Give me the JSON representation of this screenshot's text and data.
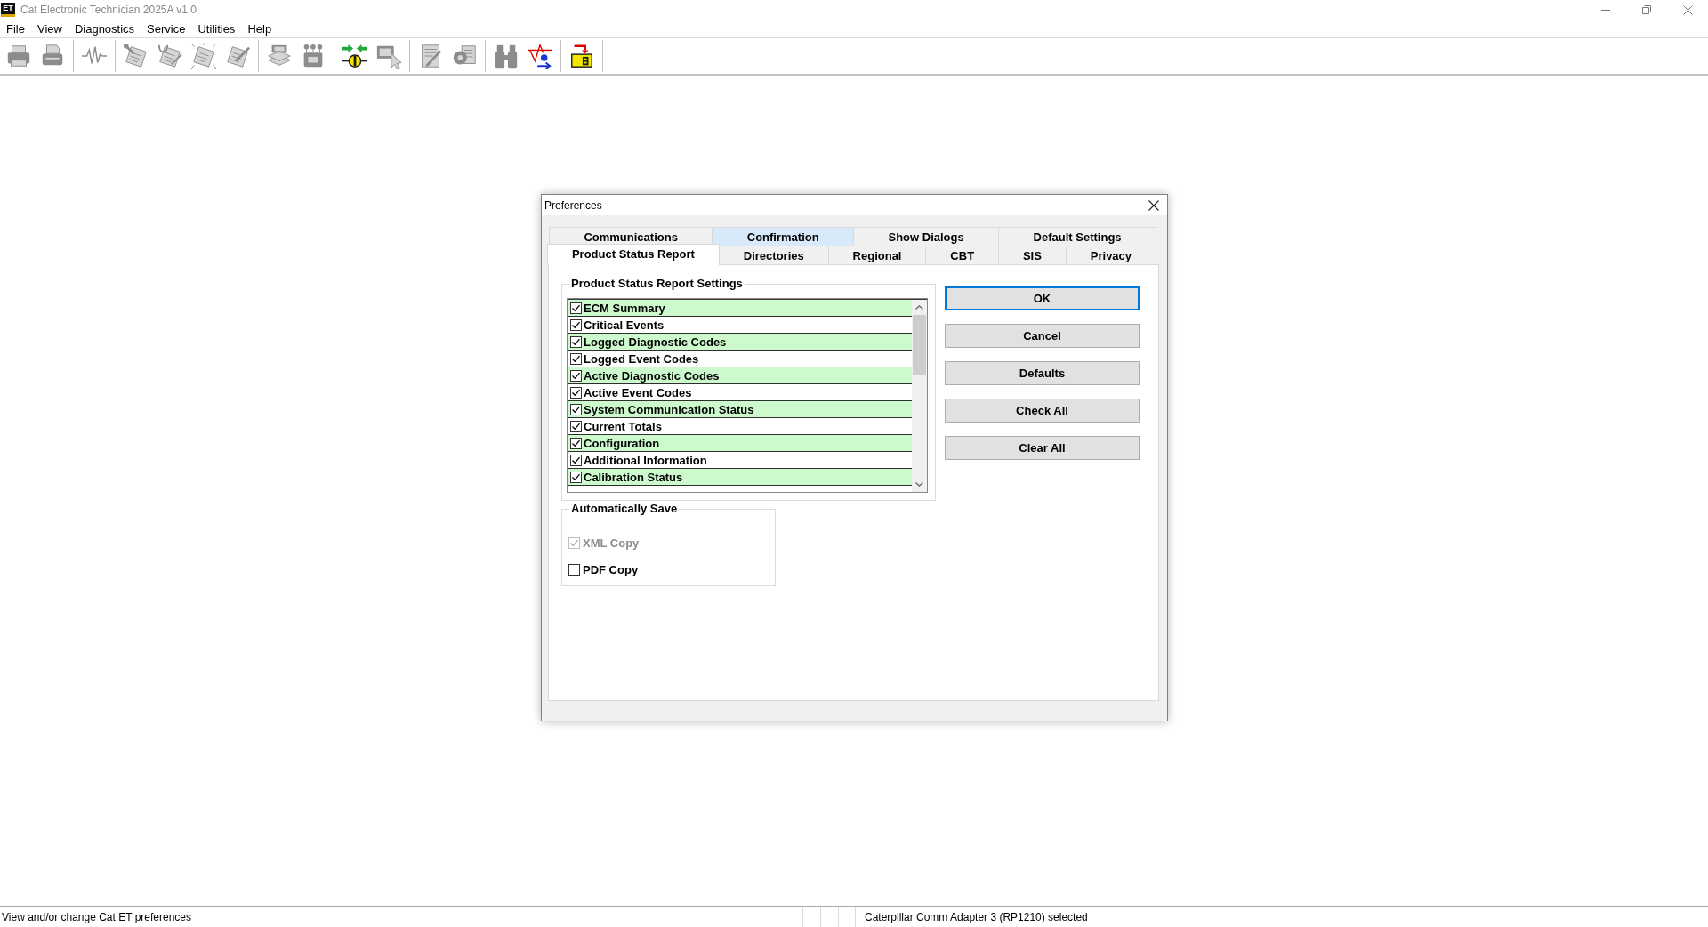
{
  "window": {
    "logo_text": "ET",
    "title": "Cat Electronic Technician 2025A v1.0"
  },
  "menu": [
    "File",
    "View",
    "Diagnostics",
    "Service",
    "Utilities",
    "Help"
  ],
  "toolbar": {
    "groups": [
      {
        "buttons": [
          {
            "kind": "printer",
            "disabled": true
          },
          {
            "kind": "printer-roll",
            "disabled": true
          }
        ]
      },
      {
        "buttons": [
          {
            "kind": "waveform",
            "disabled": true
          }
        ]
      },
      {
        "buttons": [
          {
            "kind": "wrench-doc",
            "disabled": true
          },
          {
            "kind": "stethoscope-doc",
            "disabled": true
          },
          {
            "kind": "sparkle-doc",
            "disabled": true
          },
          {
            "kind": "pen-doc",
            "disabled": true
          }
        ]
      },
      {
        "buttons": [
          {
            "kind": "stack",
            "disabled": true
          },
          {
            "kind": "module",
            "disabled": true
          }
        ]
      },
      {
        "buttons": [
          {
            "kind": "connect",
            "disabled": false
          },
          {
            "kind": "screen-cursor",
            "disabled": true
          }
        ]
      },
      {
        "buttons": [
          {
            "kind": "edit-doc",
            "disabled": true
          },
          {
            "kind": "gear-doc",
            "disabled": true
          }
        ]
      },
      {
        "buttons": [
          {
            "kind": "binoculars",
            "disabled": true
          },
          {
            "kind": "graph",
            "disabled": false
          }
        ]
      },
      {
        "buttons": [
          {
            "kind": "module-arrow",
            "disabled": false
          }
        ]
      }
    ]
  },
  "dialog": {
    "title": "Preferences",
    "tab_rows": [
      {
        "tabs": [
          {
            "label": "Communications",
            "selected": false,
            "hovered": false
          },
          {
            "label": "Confirmation",
            "selected": false,
            "hovered": true
          },
          {
            "label": "Show Dialogs",
            "selected": false,
            "hovered": false
          },
          {
            "label": "Default Settings",
            "selected": false,
            "hovered": false
          }
        ]
      },
      {
        "tabs": [
          {
            "label": "Product Status Report",
            "selected": true,
            "hovered": false
          },
          {
            "label": "Directories",
            "selected": false,
            "hovered": false
          },
          {
            "label": "Regional",
            "selected": false,
            "hovered": false
          },
          {
            "label": "CBT",
            "selected": false,
            "hovered": false
          },
          {
            "label": "SIS",
            "selected": false,
            "hovered": false
          },
          {
            "label": "Privacy",
            "selected": false,
            "hovered": false
          }
        ]
      }
    ],
    "settings_group": {
      "title": "Product Status Report Settings",
      "items": [
        {
          "label": "ECM Summary",
          "checked": true
        },
        {
          "label": "Critical Events",
          "checked": true
        },
        {
          "label": "Logged Diagnostic Codes",
          "checked": true
        },
        {
          "label": "Logged Event Codes",
          "checked": true
        },
        {
          "label": "Active Diagnostic Codes",
          "checked": true
        },
        {
          "label": "Active Event Codes",
          "checked": true
        },
        {
          "label": "System Communication Status",
          "checked": true
        },
        {
          "label": "Current Totals",
          "checked": true
        },
        {
          "label": "Configuration",
          "checked": true
        },
        {
          "label": "Additional Information",
          "checked": true
        },
        {
          "label": "Calibration Status",
          "checked": true
        }
      ]
    },
    "buttons": [
      {
        "label": "OK",
        "default": true
      },
      {
        "label": "Cancel",
        "default": false
      },
      {
        "label": "Defaults",
        "default": false
      },
      {
        "label": "Check All",
        "default": false
      },
      {
        "label": "Clear All",
        "default": false
      }
    ],
    "auto_save": {
      "title": "Automatically Save",
      "options": [
        {
          "label": "XML Copy",
          "checked": true,
          "disabled": true
        },
        {
          "label": "PDF Copy",
          "checked": false,
          "disabled": false
        }
      ]
    }
  },
  "status_bar": {
    "message": "View and/or change Cat ET preferences",
    "adapter": "Caterpillar Comm Adapter 3 (RP1210) selected"
  }
}
